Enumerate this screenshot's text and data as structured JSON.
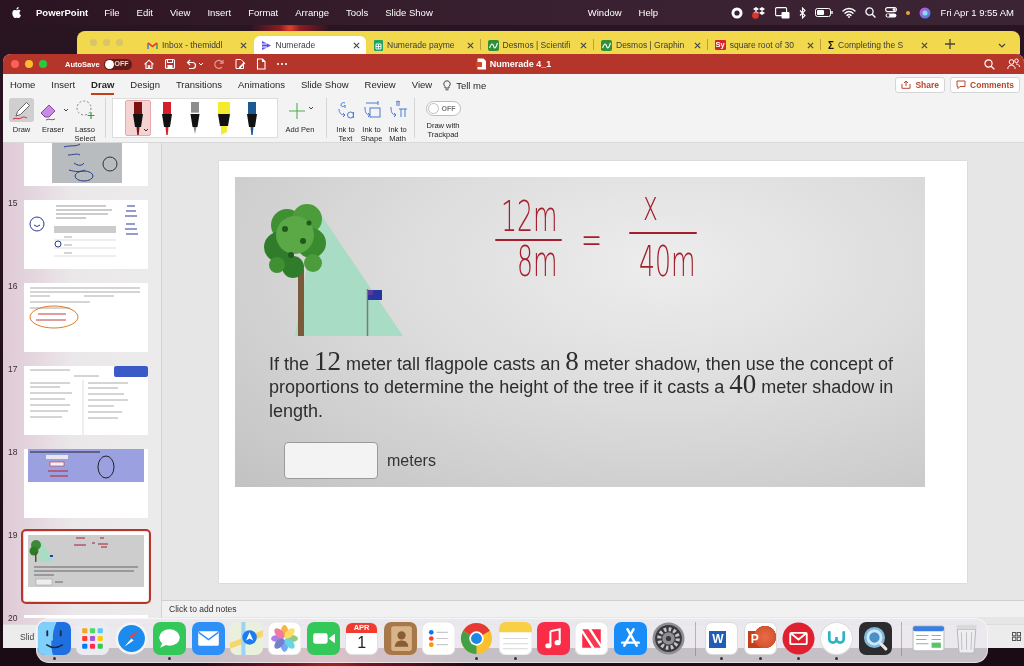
{
  "menu_bar": {
    "app_name": "PowerPoint",
    "menus": [
      "File",
      "Edit",
      "View",
      "Insert",
      "Format",
      "Arrange",
      "Tools",
      "Slide Show"
    ],
    "more_menus": [
      "Window",
      "Help"
    ],
    "clock": "Fri Apr 1 9:55 AM"
  },
  "browser": {
    "tabs": [
      {
        "kind": "mail",
        "title": "Inbox - themiddl",
        "selected": false
      },
      {
        "kind": "play",
        "title": "Numerade",
        "selected": true
      },
      {
        "kind": "sheet",
        "title": "Numerade payme",
        "selected": false
      },
      {
        "kind": "graph",
        "title": "Desmos | Scientifi",
        "selected": false
      },
      {
        "kind": "graph",
        "title": "Desmos | Graphin",
        "selected": false
      },
      {
        "kind": "letters",
        "icon_text": "Sy",
        "title": "square root of 30",
        "selected": false
      },
      {
        "kind": "symbol",
        "icon_text": "Σ",
        "title": "Completing the S",
        "selected": false
      }
    ]
  },
  "window": {
    "title": "Numerade 4_1",
    "autosave": {
      "label": "AutoSave",
      "on": false,
      "state_text": "OFF"
    }
  },
  "ribbon": {
    "tabs": [
      {
        "label": "Home",
        "selected": false
      },
      {
        "label": "Insert",
        "selected": false
      },
      {
        "label": "Draw",
        "selected": true
      },
      {
        "label": "Design",
        "selected": false
      },
      {
        "label": "Transitions",
        "selected": false
      },
      {
        "label": "Animations",
        "selected": false
      },
      {
        "label": "Slide Show",
        "selected": false
      },
      {
        "label": "Review",
        "selected": false
      },
      {
        "label": "View",
        "selected": false
      }
    ],
    "tell_me": "Tell me",
    "share": "Share",
    "comments": "Comments",
    "tools": [
      {
        "kind": "draw",
        "label": "Draw",
        "selected": true
      },
      {
        "kind": "eraser",
        "label": "Eraser",
        "selected": false
      },
      {
        "kind": "lasso",
        "label": "Lasso Select",
        "selected": false
      }
    ],
    "pens": [
      {
        "kind": "pen",
        "color": "#7c1212",
        "selected": true
      },
      {
        "kind": "pen",
        "color": "#d51f2b",
        "selected": false
      },
      {
        "kind": "pencil",
        "color": "#8d8d8d",
        "selected": false
      },
      {
        "kind": "highlighter",
        "color": "#f6ea2c",
        "selected": false
      },
      {
        "kind": "pen",
        "color": "#1d5a93",
        "selected": false
      }
    ],
    "add_pen": "Add Pen",
    "ink_tools": [
      {
        "kind": "text",
        "label": "Ink to Text"
      },
      {
        "kind": "shape",
        "label": "Ink to Shape"
      },
      {
        "kind": "math",
        "label": "Ink to Math"
      }
    ],
    "trackpad": {
      "label": "Draw with Trackpad",
      "on": false,
      "state_text": "OFF"
    }
  },
  "slides": [
    {
      "kind": "photo-ink",
      "selected": false
    },
    {
      "number": "15",
      "kind": "question-table",
      "selected": false
    },
    {
      "number": "16",
      "kind": "text-ink",
      "selected": false
    },
    {
      "number": "17",
      "kind": "two-column",
      "selected": false
    },
    {
      "number": "18",
      "kind": "blue-photo",
      "selected": false
    },
    {
      "number": "19",
      "kind": "current",
      "selected": true
    },
    {
      "number": "20",
      "kind": "blank",
      "selected": false
    }
  ],
  "slide": {
    "equation": {
      "left_top": "12m",
      "left_bottom": "8m",
      "sign": "=",
      "right_top": "x",
      "right_bottom": "40m"
    },
    "question": [
      {
        "kind": "text",
        "text": "If the"
      },
      {
        "kind": "number",
        "text": "12"
      },
      {
        "kind": "text",
        "text": "meter tall flagpole casts an"
      },
      {
        "kind": "number",
        "text": "8"
      },
      {
        "kind": "text",
        "text": "meter shadow, then use the concept of proportions to determine the height of the tree if it casts a"
      },
      {
        "kind": "number",
        "text": "40"
      },
      {
        "kind": "text",
        "text": "meter shadow in length."
      }
    ],
    "answer_unit": "meters"
  },
  "notes": {
    "placeholder": "Click to add notes"
  },
  "status_bar": {
    "text": "Slid"
  },
  "dock": {
    "sections": [
      {
        "apps": [
          {
            "kind": "finder",
            "running": true
          },
          {
            "kind": "launchpad",
            "running": false
          },
          {
            "kind": "safari",
            "running": false
          },
          {
            "kind": "messages",
            "running": true
          },
          {
            "kind": "mail",
            "running": false
          },
          {
            "kind": "maps",
            "running": false
          },
          {
            "kind": "photos",
            "running": false
          },
          {
            "kind": "facetime",
            "running": false
          },
          {
            "kind": "calendar",
            "month": "APR",
            "day": "1",
            "running": false
          },
          {
            "kind": "contacts",
            "running": false
          },
          {
            "kind": "reminders",
            "running": false
          },
          {
            "kind": "chrome",
            "running": true
          },
          {
            "kind": "notes",
            "running": true
          },
          {
            "kind": "music",
            "running": false
          },
          {
            "kind": "news",
            "running": false
          },
          {
            "kind": "appstore",
            "running": false
          },
          {
            "kind": "settings",
            "running": false
          }
        ]
      },
      {
        "apps": [
          {
            "kind": "word",
            "letter": "W",
            "running": true
          },
          {
            "kind": "slides",
            "letter": "P",
            "running": true
          },
          {
            "kind": "redmail",
            "running": true
          },
          {
            "kind": "numerade",
            "running": true
          },
          {
            "kind": "quicktime",
            "running": false
          }
        ]
      },
      {
        "apps": [
          {
            "kind": "preview",
            "running": false
          },
          {
            "kind": "trash",
            "running": false
          }
        ]
      }
    ]
  }
}
